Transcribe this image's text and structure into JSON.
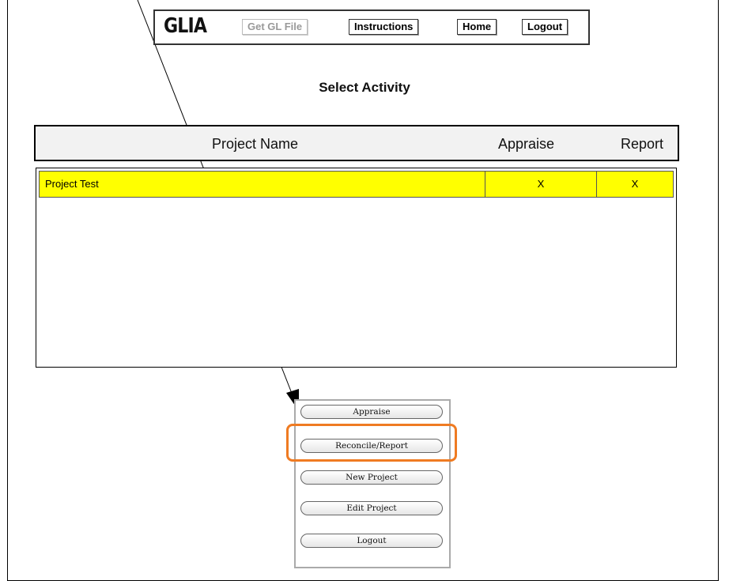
{
  "nav": {
    "logo": "GLIA",
    "get_gl_file": "Get GL File",
    "instructions": "Instructions",
    "home": "Home",
    "logout": "Logout"
  },
  "page_title": "Select Activity",
  "table": {
    "headers": {
      "name": "Project Name",
      "appraise": "Appraise",
      "report": "Report"
    },
    "rows": [
      {
        "name": "Project Test",
        "appraise": "X",
        "report": "X",
        "highlight": "#ffff00"
      }
    ]
  },
  "actions": {
    "appraise": "Appraise",
    "reconcile_report": "Reconcile/Report",
    "new_project": "New Project",
    "edit_project": "Edit Project",
    "logout": "Logout"
  },
  "annotation": {
    "highlight_color": "#ef7b22",
    "arrow_color": "#000000"
  }
}
